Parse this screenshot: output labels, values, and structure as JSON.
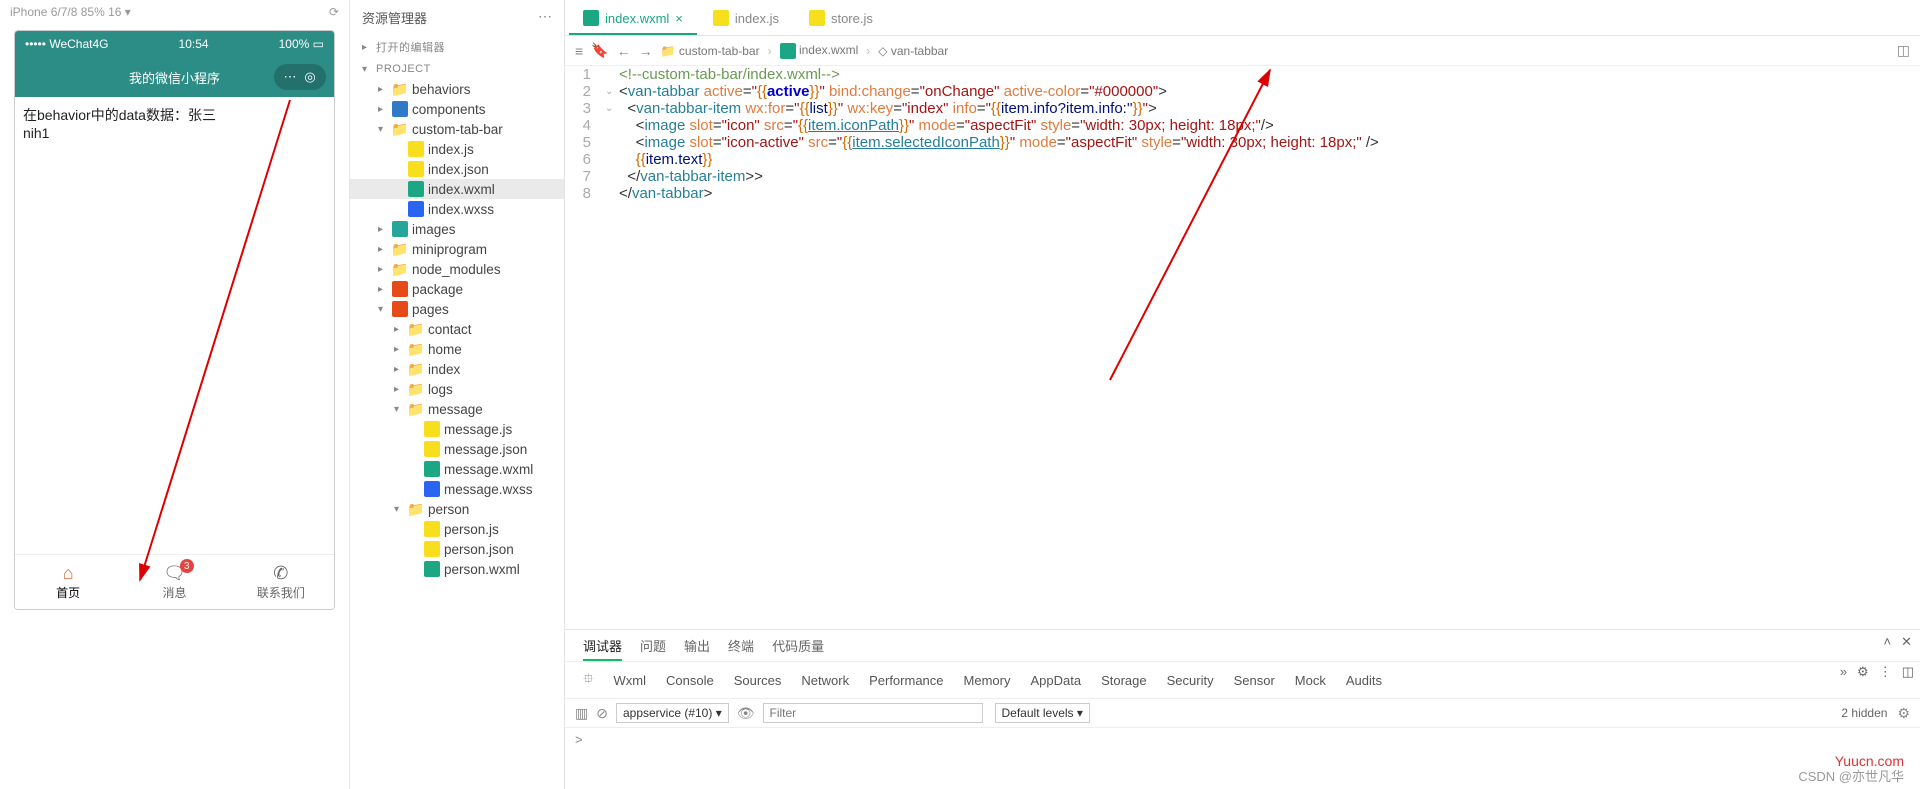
{
  "simulator": {
    "carrier": "••••• WeChat4G",
    "time": "10:54",
    "battery": "100%",
    "appTitle": "我的微信小程序",
    "pageLine1": "在behavior中的data数据：张三",
    "pageLine2": "nih1",
    "tabs": [
      {
        "label": "首页",
        "icon": "⌂",
        "active": true
      },
      {
        "label": "消息",
        "icon": "🗨",
        "badge": "3"
      },
      {
        "label": "联系我们",
        "icon": "✆"
      }
    ]
  },
  "explorer": {
    "title": "资源管理器",
    "sections": {
      "open_editors": "打开的编辑器",
      "project": "PROJECT"
    },
    "tree": [
      {
        "l": 1,
        "ch": "▸",
        "ic": "folder",
        "t": "behaviors"
      },
      {
        "l": 1,
        "ch": "▸",
        "ic": "ts",
        "t": "components"
      },
      {
        "l": 1,
        "ch": "▾",
        "ic": "folder",
        "t": "custom-tab-bar"
      },
      {
        "l": 2,
        "ch": "",
        "ic": "js",
        "t": "index.js"
      },
      {
        "l": 2,
        "ch": "",
        "ic": "json",
        "t": "index.json"
      },
      {
        "l": 2,
        "ch": "",
        "ic": "wxml",
        "t": "index.wxml",
        "sel": true
      },
      {
        "l": 2,
        "ch": "",
        "ic": "wxss",
        "t": "index.wxss"
      },
      {
        "l": 1,
        "ch": "▸",
        "ic": "img",
        "t": "images"
      },
      {
        "l": 1,
        "ch": "▸",
        "ic": "folder",
        "t": "miniprogram"
      },
      {
        "l": 1,
        "ch": "▸",
        "ic": "folder",
        "t": "node_modules"
      },
      {
        "l": 1,
        "ch": "▸",
        "ic": "pk",
        "t": "package"
      },
      {
        "l": 1,
        "ch": "▾",
        "ic": "pk",
        "t": "pages"
      },
      {
        "l": 2,
        "ch": "▸",
        "ic": "folder",
        "t": "contact"
      },
      {
        "l": 2,
        "ch": "▸",
        "ic": "folder",
        "t": "home"
      },
      {
        "l": 2,
        "ch": "▸",
        "ic": "folder",
        "t": "index"
      },
      {
        "l": 2,
        "ch": "▸",
        "ic": "folder",
        "t": "logs"
      },
      {
        "l": 2,
        "ch": "▾",
        "ic": "folder",
        "t": "message"
      },
      {
        "l": 3,
        "ch": "",
        "ic": "js",
        "t": "message.js"
      },
      {
        "l": 3,
        "ch": "",
        "ic": "json",
        "t": "message.json"
      },
      {
        "l": 3,
        "ch": "",
        "ic": "wxml",
        "t": "message.wxml"
      },
      {
        "l": 3,
        "ch": "",
        "ic": "wxss",
        "t": "message.wxss"
      },
      {
        "l": 2,
        "ch": "▾",
        "ic": "folder",
        "t": "person"
      },
      {
        "l": 3,
        "ch": "",
        "ic": "js",
        "t": "person.js"
      },
      {
        "l": 3,
        "ch": "",
        "ic": "json",
        "t": "person.json"
      },
      {
        "l": 3,
        "ch": "",
        "ic": "wxml",
        "t": "person.wxml"
      }
    ]
  },
  "editorTabs": [
    {
      "label": "index.wxml",
      "ic": "wxml",
      "active": true
    },
    {
      "label": "index.js",
      "ic": "js"
    },
    {
      "label": "store.js",
      "ic": "js"
    }
  ],
  "breadcrumb": [
    "custom-tab-bar",
    "index.wxml",
    "van-tabbar"
  ],
  "code": [
    {
      "n": 1,
      "f": "",
      "html": "<span class='c-cm'>&lt;!--custom-tab-bar/index.wxml--&gt;</span>"
    },
    {
      "n": 2,
      "f": "⌄",
      "html": "<span class='c-pun'>&lt;</span><span class='c-tag'>van-tabbar</span> <span class='c-attr'>active</span>=<span class='c-str'>\"</span><span class='c-br'>{{</span><span class='c-active'>active</span><span class='c-br'>}}</span><span class='c-str'>\"</span> <span class='c-attr'>bind:change</span>=<span class='c-str'>\"onChange\"</span> <span class='c-attr'>active-color</span>=<span class='c-str'>\"#000000\"</span><span class='c-pun'>&gt;</span>"
    },
    {
      "n": 3,
      "f": "⌄",
      "html": "  <span class='c-pun'>&lt;</span><span class='c-tag'>van-tabbar-item</span> <span class='c-attr'>wx:for</span>=<span class='c-str'>\"</span><span class='c-br'>{{</span><span class='c-val'>list</span><span class='c-br'>}}</span><span class='c-str'>\"</span> <span class='c-attr'>wx:key</span>=<span class='c-str'>\"index\"</span> <span class='c-attr'>info</span>=<span class='c-str'>\"</span><span class='c-br'>{{</span><span class='c-val'>item.info?item.info:''</span><span class='c-br'>}}</span><span class='c-str'>\"</span><span class='c-pun'>&gt;</span>"
    },
    {
      "n": 4,
      "f": "",
      "html": "    <span class='c-pun'>&lt;</span><span class='c-tag'>image</span> <span class='c-attr'>slot</span>=<span class='c-str'>\"icon\"</span> <span class='c-attr'>src</span>=<span class='c-str'>\"</span><span class='c-br'>{{</span><span class='c-bind'>item.iconPath</span><span class='c-br'>}}</span><span class='c-str'>\"</span> <span class='c-attr'>mode</span>=<span class='c-str'>\"aspectFit\"</span> <span class='c-attr'>style</span>=<span class='c-str'>\"width: 30px; height: 18px;\"</span><span class='c-pun'>/&gt;</span>"
    },
    {
      "n": 5,
      "f": "",
      "html": "    <span class='c-pun'>&lt;</span><span class='c-tag'>image</span> <span class='c-attr'>slot</span>=<span class='c-str'>\"icon-active\"</span> <span class='c-attr'>src</span>=<span class='c-str'>\"</span><span class='c-br'>{{</span><span class='c-bind'>item.selectedIconPath</span><span class='c-br'>}}</span><span class='c-str'>\"</span> <span class='c-attr'>mode</span>=<span class='c-str'>\"aspectFit\"</span> <span class='c-attr'>style</span>=<span class='c-str'>\"width: 30px; height: 18px;\"</span> <span class='c-pun'>/&gt;</span>"
    },
    {
      "n": 6,
      "f": "",
      "html": "    <span class='c-br'>{{</span><span class='c-val'>item.text</span><span class='c-br'>}}</span>"
    },
    {
      "n": 7,
      "f": "",
      "html": "  <span class='c-pun'>&lt;/</span><span class='c-tag'>van-tabbar-item</span><span class='c-pun'>&gt;&gt;</span>"
    },
    {
      "n": 8,
      "f": "",
      "html": "<span class='c-pun'>&lt;/</span><span class='c-tag'>van-tabbar</span><span class='c-pun'>&gt;</span>"
    }
  ],
  "devtools": {
    "tabs1": [
      "调试器",
      "问题",
      "输出",
      "终端",
      "代码质量"
    ],
    "tabs2": [
      "Wxml",
      "Console",
      "Sources",
      "Network",
      "Performance",
      "Memory",
      "AppData",
      "Storage",
      "Security",
      "Sensor",
      "Mock",
      "Audits"
    ],
    "activeTab1": "调试器",
    "activeTab2": "Console",
    "context": "appservice (#10)",
    "filterPlaceholder": "Filter",
    "levels": "Default levels",
    "hidden": "2 hidden",
    "prompt": ">"
  },
  "watermark": "Yuucn.com",
  "watermark2": "CSDN @亦世凡华"
}
